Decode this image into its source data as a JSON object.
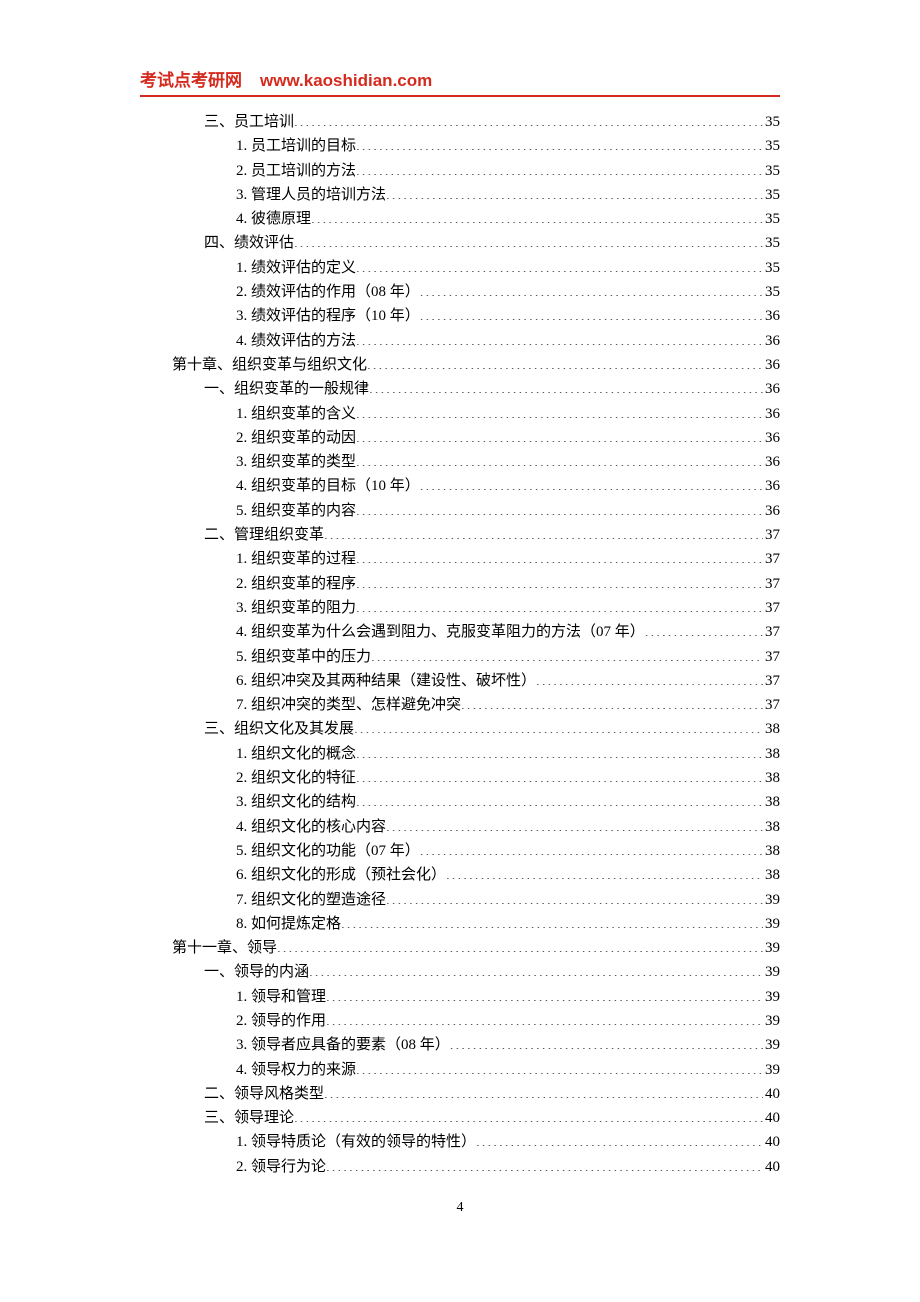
{
  "header": {
    "site_name": "考试点考研网",
    "site_url": "www.kaoshidian.com"
  },
  "toc": [
    {
      "indent": 2,
      "title": "三、员工培训",
      "page": "35"
    },
    {
      "indent": 3,
      "title": "1. 员工培训的目标",
      "page": "35"
    },
    {
      "indent": 3,
      "title": "2. 员工培训的方法",
      "page": "35"
    },
    {
      "indent": 3,
      "title": "3. 管理人员的培训方法",
      "page": "35"
    },
    {
      "indent": 3,
      "title": "4. 彼德原理",
      "page": "35"
    },
    {
      "indent": 2,
      "title": "四、绩效评估",
      "page": "35"
    },
    {
      "indent": 3,
      "title": "1. 绩效评估的定义",
      "page": "35"
    },
    {
      "indent": 3,
      "title": "2. 绩效评估的作用（08 年）",
      "page": "35"
    },
    {
      "indent": 3,
      "title": "3. 绩效评估的程序（10 年）",
      "page": "36"
    },
    {
      "indent": 3,
      "title": "4. 绩效评估的方法",
      "page": "36"
    },
    {
      "indent": 1,
      "title": "第十章、组织变革与组织文化",
      "page": "36"
    },
    {
      "indent": 2,
      "title": "一、组织变革的一般规律",
      "page": "36"
    },
    {
      "indent": 3,
      "title": "1. 组织变革的含义",
      "page": "36"
    },
    {
      "indent": 3,
      "title": "2. 组织变革的动因",
      "page": "36"
    },
    {
      "indent": 3,
      "title": "3. 组织变革的类型",
      "page": "36"
    },
    {
      "indent": 3,
      "title": "4. 组织变革的目标（10 年）",
      "page": "36"
    },
    {
      "indent": 3,
      "title": "5. 组织变革的内容",
      "page": "36"
    },
    {
      "indent": 2,
      "title": "二、管理组织变革",
      "page": "37"
    },
    {
      "indent": 3,
      "title": "1. 组织变革的过程",
      "page": "37"
    },
    {
      "indent": 3,
      "title": "2. 组织变革的程序",
      "page": "37"
    },
    {
      "indent": 3,
      "title": "3. 组织变革的阻力",
      "page": "37"
    },
    {
      "indent": 3,
      "title": "4. 组织变革为什么会遇到阻力、克服变革阻力的方法（07 年）",
      "page": "37"
    },
    {
      "indent": 3,
      "title": "5. 组织变革中的压力",
      "page": "37"
    },
    {
      "indent": 3,
      "title": "6. 组织冲突及其两种结果（建设性、破坏性）",
      "page": "37"
    },
    {
      "indent": 3,
      "title": "7. 组织冲突的类型、怎样避免冲突",
      "page": "37"
    },
    {
      "indent": 2,
      "title": "三、组织文化及其发展",
      "page": "38"
    },
    {
      "indent": 3,
      "title": "1. 组织文化的概念",
      "page": "38"
    },
    {
      "indent": 3,
      "title": "2. 组织文化的特征",
      "page": "38"
    },
    {
      "indent": 3,
      "title": "3. 组织文化的结构",
      "page": "38"
    },
    {
      "indent": 3,
      "title": "4. 组织文化的核心内容",
      "page": "38"
    },
    {
      "indent": 3,
      "title": "5. 组织文化的功能（07 年）",
      "page": "38"
    },
    {
      "indent": 3,
      "title": "6. 组织文化的形成（预社会化）",
      "page": "38"
    },
    {
      "indent": 3,
      "title": "7. 组织文化的塑造途径",
      "page": "39"
    },
    {
      "indent": 3,
      "title": "8. 如何提炼定格",
      "page": "39"
    },
    {
      "indent": 1,
      "title": "第十一章、领导",
      "page": "39"
    },
    {
      "indent": 2,
      "title": "一、领导的内涵",
      "page": "39"
    },
    {
      "indent": 3,
      "title": "1. 领导和管理",
      "page": "39"
    },
    {
      "indent": 3,
      "title": "2. 领导的作用",
      "page": "39"
    },
    {
      "indent": 3,
      "title": "3. 领导者应具备的要素（08 年）",
      "page": "39"
    },
    {
      "indent": 3,
      "title": "4. 领导权力的来源",
      "page": "39"
    },
    {
      "indent": 2,
      "title": "二、领导风格类型",
      "page": "40"
    },
    {
      "indent": 2,
      "title": "三、领导理论",
      "page": "40"
    },
    {
      "indent": 3,
      "title": "1. 领导特质论（有效的领导的特性）",
      "page": "40"
    },
    {
      "indent": 3,
      "title": "2. 领导行为论",
      "page": "40"
    }
  ],
  "footer": {
    "page_number": "4"
  }
}
